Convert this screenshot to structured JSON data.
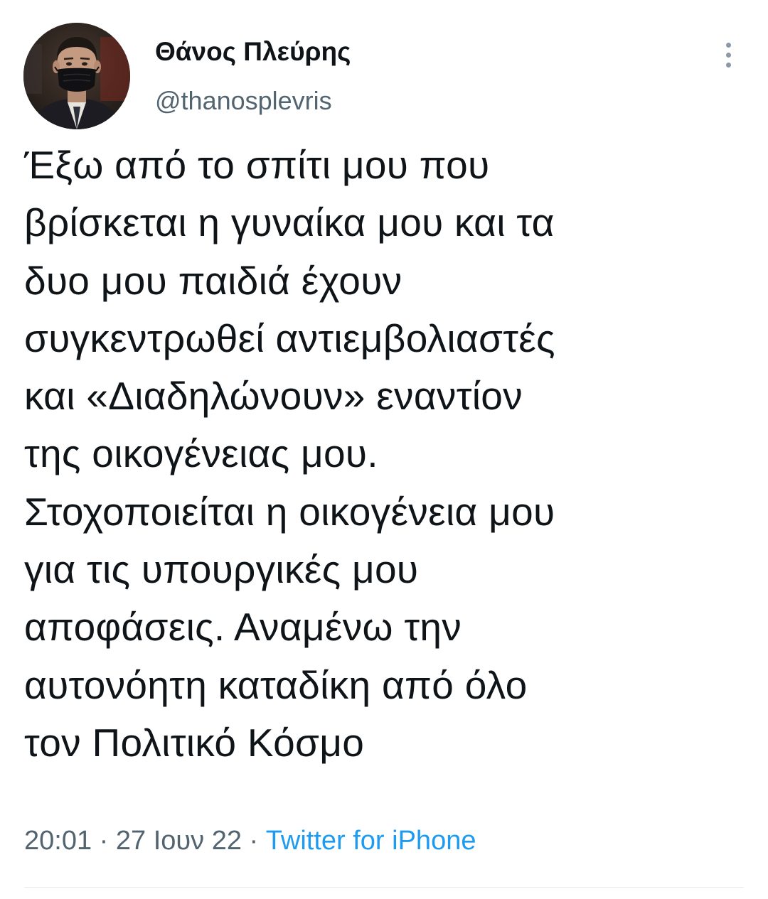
{
  "author": {
    "name": "Θάνος Πλεύρης",
    "handle": "@thanosplevris",
    "avatar_icon": "profile-photo"
  },
  "more_icon": "more-vertical-icon",
  "tweet": {
    "lines": [
      "Έξω από το σπίτι μου που",
      "βρίσκεται η γυναίκα μου και τα",
      "δυο μου παιδιά έχουν",
      "συγκεντρωθεί αντιεμβολιαστές",
      "και «Διαδηλώνουν» εναντίον",
      "της οικογένειας μου.",
      "Στοχοποιείται η οικογένεια μου",
      "για τις υπουργικές μου",
      "αποφάσεις. Αναμένω την",
      "αυτονόητη καταδίκη από όλο",
      "τον Πολιτικό Κόσμο"
    ]
  },
  "meta": {
    "time": "20:01",
    "separator": " · ",
    "date": "27 Ιουν 22",
    "source": "Twitter for iPhone"
  },
  "colors": {
    "text": "#0f1419",
    "secondary": "#536471",
    "link": "#1d9bf0",
    "divider": "#e6ecf0"
  }
}
